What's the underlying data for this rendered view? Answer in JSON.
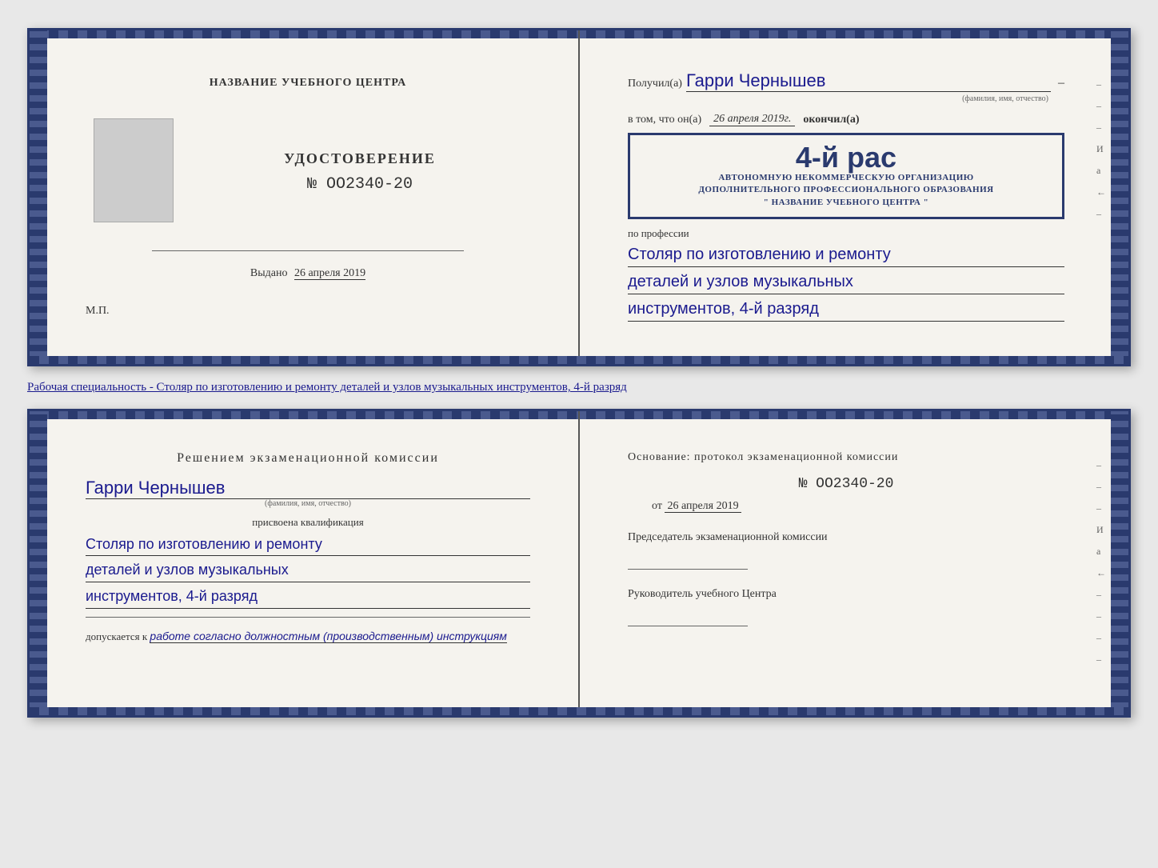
{
  "doc1": {
    "left": {
      "center_title": "НАЗВАНИЕ УЧЕБНОГО ЦЕНТРА",
      "cert_label": "УДОСТОВЕРЕНИЕ",
      "cert_number": "№ OO2340-20",
      "issued_label": "Выдано",
      "issued_date": "26 апреля 2019",
      "mp": "М.П."
    },
    "right": {
      "received_label": "Получил(а)",
      "recipient_name": "Гарри Чернышев",
      "fio_hint": "(фамилия, имя, отчество)",
      "vtom_label": "в том, что он(а)",
      "date_value": "26 апреля 2019г.",
      "okончил_label": "окончил(а)",
      "org_line1": "АВТОНОМНУЮ НЕКОММЕРЧЕСКУЮ ОРГАНИЗАЦИЮ",
      "org_line2": "ДОПОЛНИТЕЛЬНОГО ПРОФЕССИОНАЛЬНОГО ОБРАЗОВАНИЯ",
      "org_line3": "\" НАЗВАНИЕ УЧЕБНОГО ЦЕНТРА \"",
      "profession_label": "по профессии",
      "profession_line1": "Столяр по изготовлению и ремонту",
      "profession_line2": "деталей и узлов музыкальных",
      "profession_line3": "инструментов, 4-й разряд"
    }
  },
  "description": "Рабочая специальность - Столяр по изготовлению и ремонту деталей и узлов музыкальных инструментов, 4-й разряд",
  "doc2": {
    "left": {
      "decision_title": "Решением  экзаменационной  комиссии",
      "name_value": "Гарри Чернышев",
      "fio_hint": "(фамилия, имя, отчество)",
      "qualification_label": "присвоена квалификация",
      "qualification_line1": "Столяр по изготовлению и ремонту",
      "qualification_line2": "деталей и узлов музыкальных",
      "qualification_line3": "инструментов, 4-й разряд",
      "allowed_label": "допускается к",
      "allowed_value": "работе согласно должностным (производственным) инструкциям"
    },
    "right": {
      "basis_label": "Основание: протокол экзаменационной  комиссии",
      "protocol_number": "№  OO2340-20",
      "protocol_date_prefix": "от",
      "protocol_date": "26 апреля 2019",
      "chairman_label": "Председатель экзаменационной комиссии",
      "head_label": "Руководитель учебного Центра"
    }
  },
  "side_marks": [
    "–",
    "–",
    "–",
    "И",
    "а",
    "←",
    "–",
    "–",
    "–",
    "–"
  ]
}
